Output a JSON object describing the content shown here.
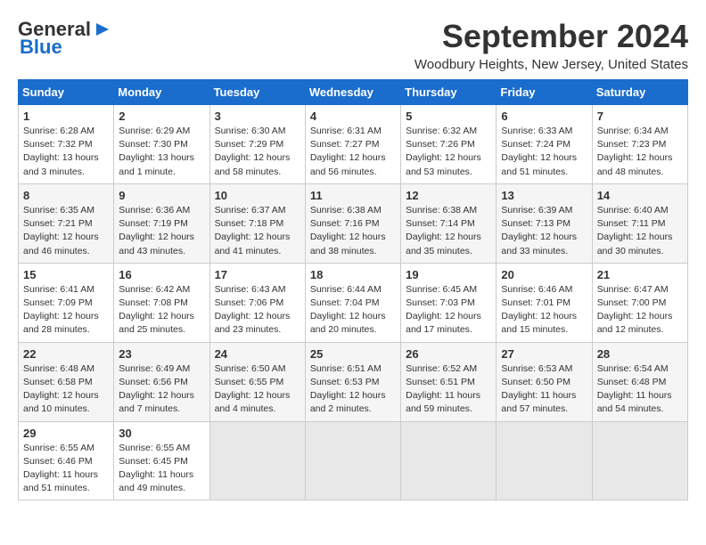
{
  "header": {
    "logo_general": "General",
    "logo_blue": "Blue",
    "month_year": "September 2024",
    "location": "Woodbury Heights, New Jersey, United States"
  },
  "days_of_week": [
    "Sunday",
    "Monday",
    "Tuesday",
    "Wednesday",
    "Thursday",
    "Friday",
    "Saturday"
  ],
  "weeks": [
    [
      {
        "day": "1",
        "sunrise": "6:28 AM",
        "sunset": "7:32 PM",
        "daylight": "13 hours and 3 minutes."
      },
      {
        "day": "2",
        "sunrise": "6:29 AM",
        "sunset": "7:30 PM",
        "daylight": "13 hours and 1 minute."
      },
      {
        "day": "3",
        "sunrise": "6:30 AM",
        "sunset": "7:29 PM",
        "daylight": "12 hours and 58 minutes."
      },
      {
        "day": "4",
        "sunrise": "6:31 AM",
        "sunset": "7:27 PM",
        "daylight": "12 hours and 56 minutes."
      },
      {
        "day": "5",
        "sunrise": "6:32 AM",
        "sunset": "7:26 PM",
        "daylight": "12 hours and 53 minutes."
      },
      {
        "day": "6",
        "sunrise": "6:33 AM",
        "sunset": "7:24 PM",
        "daylight": "12 hours and 51 minutes."
      },
      {
        "day": "7",
        "sunrise": "6:34 AM",
        "sunset": "7:23 PM",
        "daylight": "12 hours and 48 minutes."
      }
    ],
    [
      {
        "day": "8",
        "sunrise": "6:35 AM",
        "sunset": "7:21 PM",
        "daylight": "12 hours and 46 minutes."
      },
      {
        "day": "9",
        "sunrise": "6:36 AM",
        "sunset": "7:19 PM",
        "daylight": "12 hours and 43 minutes."
      },
      {
        "day": "10",
        "sunrise": "6:37 AM",
        "sunset": "7:18 PM",
        "daylight": "12 hours and 41 minutes."
      },
      {
        "day": "11",
        "sunrise": "6:38 AM",
        "sunset": "7:16 PM",
        "daylight": "12 hours and 38 minutes."
      },
      {
        "day": "12",
        "sunrise": "6:38 AM",
        "sunset": "7:14 PM",
        "daylight": "12 hours and 35 minutes."
      },
      {
        "day": "13",
        "sunrise": "6:39 AM",
        "sunset": "7:13 PM",
        "daylight": "12 hours and 33 minutes."
      },
      {
        "day": "14",
        "sunrise": "6:40 AM",
        "sunset": "7:11 PM",
        "daylight": "12 hours and 30 minutes."
      }
    ],
    [
      {
        "day": "15",
        "sunrise": "6:41 AM",
        "sunset": "7:09 PM",
        "daylight": "12 hours and 28 minutes."
      },
      {
        "day": "16",
        "sunrise": "6:42 AM",
        "sunset": "7:08 PM",
        "daylight": "12 hours and 25 minutes."
      },
      {
        "day": "17",
        "sunrise": "6:43 AM",
        "sunset": "7:06 PM",
        "daylight": "12 hours and 23 minutes."
      },
      {
        "day": "18",
        "sunrise": "6:44 AM",
        "sunset": "7:04 PM",
        "daylight": "12 hours and 20 minutes."
      },
      {
        "day": "19",
        "sunrise": "6:45 AM",
        "sunset": "7:03 PM",
        "daylight": "12 hours and 17 minutes."
      },
      {
        "day": "20",
        "sunrise": "6:46 AM",
        "sunset": "7:01 PM",
        "daylight": "12 hours and 15 minutes."
      },
      {
        "day": "21",
        "sunrise": "6:47 AM",
        "sunset": "7:00 PM",
        "daylight": "12 hours and 12 minutes."
      }
    ],
    [
      {
        "day": "22",
        "sunrise": "6:48 AM",
        "sunset": "6:58 PM",
        "daylight": "12 hours and 10 minutes."
      },
      {
        "day": "23",
        "sunrise": "6:49 AM",
        "sunset": "6:56 PM",
        "daylight": "12 hours and 7 minutes."
      },
      {
        "day": "24",
        "sunrise": "6:50 AM",
        "sunset": "6:55 PM",
        "daylight": "12 hours and 4 minutes."
      },
      {
        "day": "25",
        "sunrise": "6:51 AM",
        "sunset": "6:53 PM",
        "daylight": "12 hours and 2 minutes."
      },
      {
        "day": "26",
        "sunrise": "6:52 AM",
        "sunset": "6:51 PM",
        "daylight": "11 hours and 59 minutes."
      },
      {
        "day": "27",
        "sunrise": "6:53 AM",
        "sunset": "6:50 PM",
        "daylight": "11 hours and 57 minutes."
      },
      {
        "day": "28",
        "sunrise": "6:54 AM",
        "sunset": "6:48 PM",
        "daylight": "11 hours and 54 minutes."
      }
    ],
    [
      {
        "day": "29",
        "sunrise": "6:55 AM",
        "sunset": "6:46 PM",
        "daylight": "11 hours and 51 minutes."
      },
      {
        "day": "30",
        "sunrise": "6:55 AM",
        "sunset": "6:45 PM",
        "daylight": "11 hours and 49 minutes."
      },
      null,
      null,
      null,
      null,
      null
    ]
  ]
}
